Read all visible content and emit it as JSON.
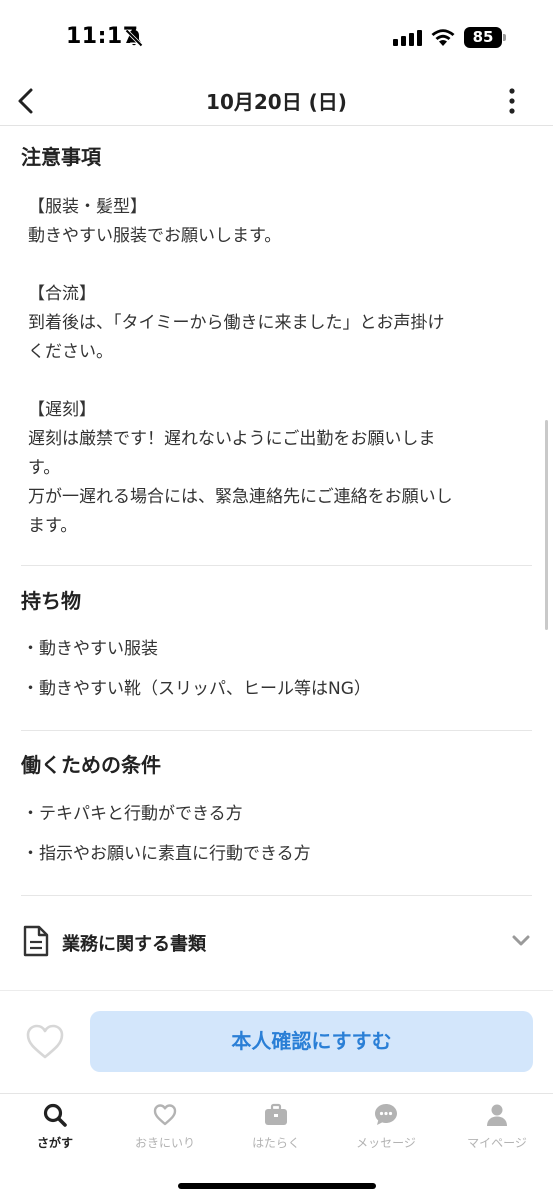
{
  "status_bar": {
    "time": "11:17",
    "battery": "85"
  },
  "header": {
    "title": "10月20日 (日)"
  },
  "notes": {
    "title": "注意事項",
    "clothing_heading": "【服装・髪型】",
    "clothing_text": "動きやすい服装でお願いします。",
    "meeting_heading": "【合流】",
    "meeting_line1": "到着後は、「タイミーから働きに来ました」とお声掛け",
    "meeting_line2": "ください。",
    "late_heading": "【遅刻】",
    "late_line1": "遅刻は厳禁です！遅れないようにご出勤をお願いしま",
    "late_line2": "す。",
    "late_line3": "万が一遅れる場合には、緊急連絡先にご連絡をお願いし",
    "late_line4": "ます。"
  },
  "belongings": {
    "title": "持ち物",
    "items": [
      "・動きやすい服装",
      "・動きやすい靴（スリッパ、ヒール等はNG）"
    ]
  },
  "conditions": {
    "title": "働くための条件",
    "items": [
      "・テキパキと行動ができる方",
      "・指示やお願いに素直に行動できる方"
    ]
  },
  "documents": {
    "label": "業務に関する書類"
  },
  "actions": {
    "confirm_label": "本人確認にすすむ"
  },
  "tab_bar": {
    "items": [
      {
        "label": "さがす",
        "icon": "search-icon",
        "active": true
      },
      {
        "label": "おきにいり",
        "icon": "heart-icon",
        "active": false
      },
      {
        "label": "はたらく",
        "icon": "briefcase-icon",
        "active": false
      },
      {
        "label": "メッセージ",
        "icon": "chat-icon",
        "active": false
      },
      {
        "label": "マイページ",
        "icon": "person-icon",
        "active": false
      }
    ]
  },
  "colors": {
    "accent": "#2a7fd6",
    "button_bg": "#d3e6fb",
    "inactive_tab": "#b3b3b3"
  }
}
